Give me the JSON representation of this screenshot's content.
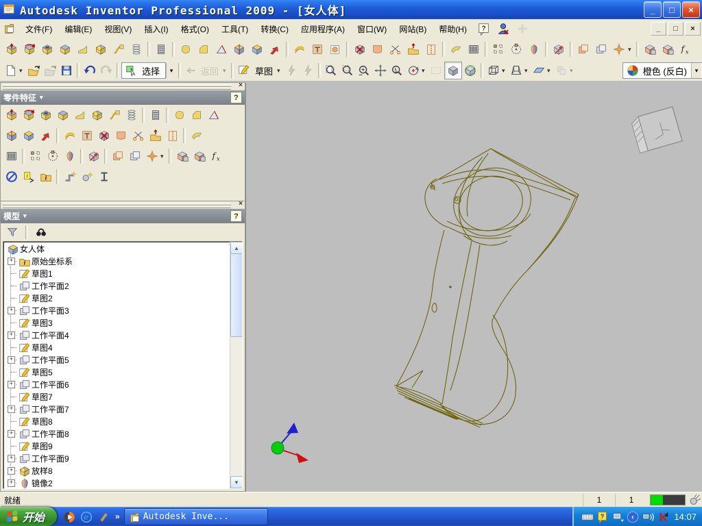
{
  "window": {
    "title": "Autodesk Inventor Professional 2009 - [女人体]",
    "buttons": {
      "minimize": "_",
      "restore": "□",
      "close": "×"
    }
  },
  "menubar": {
    "items": [
      {
        "id": "file",
        "label": "文件(F)"
      },
      {
        "id": "edit",
        "label": "编辑(E)"
      },
      {
        "id": "view",
        "label": "视图(V)"
      },
      {
        "id": "insert",
        "label": "插入(I)"
      },
      {
        "id": "format",
        "label": "格式(O)"
      },
      {
        "id": "tools",
        "label": "工具(T)"
      },
      {
        "id": "convert",
        "label": "转换(C)"
      },
      {
        "id": "applications",
        "label": "应用程序(A)"
      },
      {
        "id": "window",
        "label": "窗口(W)"
      },
      {
        "id": "web",
        "label": "网站(B)"
      },
      {
        "id": "help",
        "label": "帮助(H)"
      }
    ],
    "help_button": "?",
    "mdi_buttons": {
      "minimize": "_",
      "restore": "□",
      "close": "×"
    }
  },
  "toolbar_features": {
    "icons": [
      {
        "n": "extrude",
        "g": "arrow"
      },
      {
        "n": "revolve",
        "g": "arc"
      },
      {
        "n": "hole",
        "g": "hole"
      },
      {
        "n": "shell",
        "g": "cy"
      },
      {
        "n": "rib",
        "g": "rib"
      },
      {
        "n": "loft",
        "g": "ballcube"
      },
      {
        "n": "sweep",
        "g": "sweep"
      },
      {
        "n": "coil",
        "g": "spring"
      },
      "|",
      {
        "n": "thread",
        "g": "thread"
      },
      "|",
      {
        "n": "fillet",
        "g": "fillet"
      },
      {
        "n": "chamfer",
        "g": "chamfer"
      },
      {
        "n": "face-draft",
        "g": "wedge"
      },
      {
        "n": "split",
        "g": "split"
      },
      {
        "n": "bend-part",
        "g": "cb"
      },
      {
        "n": "move-face",
        "g": "moveface"
      },
      "|",
      {
        "n": "thicken-offset",
        "g": "thick"
      },
      {
        "n": "emboss",
        "g": "emboss"
      },
      {
        "n": "decal",
        "g": "decal"
      },
      "|",
      {
        "n": "delete-face",
        "g": "xcube"
      },
      {
        "n": "boundary-patch",
        "g": "patch"
      },
      {
        "n": "trim-surface",
        "g": "scissors"
      },
      {
        "n": "replace-face",
        "g": "promote"
      },
      {
        "n": "stitch-surface",
        "g": "stitch"
      },
      "|",
      {
        "n": "sculpt",
        "g": "sculpt"
      },
      {
        "n": "grill",
        "g": "barcode"
      },
      "|",
      {
        "n": "rectangular-pattern",
        "g": "dotsR"
      },
      {
        "n": "circular-pattern",
        "g": "dotsC"
      },
      {
        "n": "mirror",
        "g": "mirror"
      },
      "|",
      {
        "n": "move-body",
        "g": "movebody"
      },
      "|",
      {
        "n": "copy-object",
        "g": "copy"
      },
      {
        "n": "work-plane",
        "g": "wp"
      },
      {
        "n": "work-point",
        "g": "star",
        "caret": true
      },
      "|",
      {
        "n": "derive",
        "g": "cubes2"
      },
      {
        "n": "insert-ifeature",
        "g": "cubes2"
      },
      {
        "n": "parameters",
        "g": "fx"
      }
    ]
  },
  "toolbar_standard": {
    "select_label": "选择",
    "back_label": "返回",
    "sketch_label": "草图",
    "color_value": "橙色 (反白)"
  },
  "panel_features": {
    "title": "零件特征",
    "help": "?",
    "rows": [
      [
        {
          "n": "extrude",
          "g": "arrow"
        },
        {
          "n": "revolve",
          "g": "arc"
        },
        {
          "n": "hole",
          "g": "hole"
        },
        {
          "n": "shell",
          "g": "cy"
        },
        {
          "n": "rib",
          "g": "rib"
        },
        {
          "n": "loft",
          "g": "ballcube"
        },
        {
          "n": "sweep",
          "g": "sweep"
        },
        {
          "n": "coil",
          "g": "spring"
        },
        "|",
        {
          "n": "thread",
          "g": "thread"
        },
        "|",
        {
          "n": "fillet",
          "g": "fillet"
        },
        {
          "n": "chamfer",
          "g": "chamfer"
        },
        {
          "n": "face-draft",
          "g": "wedge"
        }
      ],
      [
        {
          "n": "split",
          "g": "split"
        },
        {
          "n": "bend-part",
          "g": "cb"
        },
        {
          "n": "move-face",
          "g": "moveface"
        },
        "|",
        {
          "n": "thicken-offset",
          "g": "thick"
        },
        {
          "n": "emboss",
          "g": "emboss"
        },
        {
          "n": "delete-face",
          "g": "xcube"
        },
        {
          "n": "boundary-patch",
          "g": "patch"
        },
        {
          "n": "trim-surface",
          "g": "scissors"
        },
        {
          "n": "replace-face",
          "g": "promote"
        },
        {
          "n": "stitch-surface",
          "g": "stitch"
        },
        "|",
        {
          "n": "sculpt",
          "g": "sculpt"
        }
      ],
      [
        {
          "n": "grill",
          "g": "barcode"
        },
        "|",
        {
          "n": "rectangular-pattern",
          "g": "dotsR"
        },
        {
          "n": "circular-pattern",
          "g": "dotsC"
        },
        {
          "n": "mirror",
          "g": "mirror"
        },
        "|",
        {
          "n": "move-body",
          "g": "movebody"
        },
        "|",
        {
          "n": "copy-object",
          "g": "copy"
        },
        {
          "n": "work-plane",
          "g": "wp"
        },
        {
          "n": "work-point",
          "g": "star",
          "caret": true
        },
        "|",
        {
          "n": "derive",
          "g": "cubes2"
        },
        {
          "n": "insert-ifeature",
          "g": "cubes2"
        },
        {
          "n": "parameters",
          "g": "fx"
        }
      ],
      [
        {
          "n": "disable-feature",
          "g": "nosym"
        },
        {
          "n": "create-note",
          "g": "infoNote"
        },
        {
          "n": "ifeature-catalog",
          "g": "infoFolder"
        },
        "|",
        {
          "n": "create-imate",
          "g": "imate1"
        },
        {
          "n": "composite-imate",
          "g": "imate2"
        },
        {
          "n": "structural-profile",
          "g": "ibeam"
        }
      ]
    ]
  },
  "panel_model": {
    "title": "模型",
    "help": "?",
    "tools": [
      {
        "n": "filter",
        "g": "funnel"
      },
      {
        "n": "find",
        "g": "binoc"
      }
    ],
    "tree": [
      {
        "label": "女人体",
        "icon": "part",
        "root": true
      },
      {
        "label": "原始坐标系",
        "icon": "folder",
        "expand": true
      },
      {
        "label": "草图1",
        "icon": "sketch"
      },
      {
        "label": "工作平面2",
        "icon": "workplane"
      },
      {
        "label": "草图2",
        "icon": "sketch"
      },
      {
        "label": "工作平面3",
        "icon": "workplane",
        "expand": true
      },
      {
        "label": "草图3",
        "icon": "sketch"
      },
      {
        "label": "工作平面4",
        "icon": "workplane",
        "expand": true
      },
      {
        "label": "草图4",
        "icon": "sketch"
      },
      {
        "label": "工作平面5",
        "icon": "workplane",
        "expand": true
      },
      {
        "label": "草图5",
        "icon": "sketch"
      },
      {
        "label": "工作平面6",
        "icon": "workplane",
        "expand": true
      },
      {
        "label": "草图7",
        "icon": "sketch"
      },
      {
        "label": "工作平面7",
        "icon": "workplane",
        "expand": true
      },
      {
        "label": "草图8",
        "icon": "sketch"
      },
      {
        "label": "工作平面8",
        "icon": "workplane",
        "expand": true
      },
      {
        "label": "草图9",
        "icon": "sketch"
      },
      {
        "label": "工作平面9",
        "icon": "workplane",
        "expand": true
      },
      {
        "label": "放样8",
        "icon": "loft",
        "expand": true
      },
      {
        "label": "镜像2",
        "icon": "mirrorTree",
        "expand": true
      }
    ]
  },
  "canvas": {
    "background": "#BEBEBE",
    "wire_color": "#6F650F"
  },
  "statusbar": {
    "ready": "就绪",
    "cells": [
      "1",
      "1"
    ]
  },
  "taskbar": {
    "start_label": "开始",
    "quick_launch": [
      {
        "n": "media-player",
        "g": "media"
      },
      {
        "n": "internet-explorer",
        "g": "ie"
      },
      {
        "n": "paint-brush",
        "g": "brush"
      }
    ],
    "task_label": "Autodesk Inve...",
    "tray_icons": [
      {
        "n": "keyboard",
        "g": "kbd"
      },
      {
        "n": "help-tray",
        "g": "helpTray"
      },
      {
        "n": "updates",
        "g": "winupd"
      },
      {
        "n": "language",
        "g": "langCirc"
      },
      {
        "n": "network",
        "g": "netmon"
      },
      {
        "n": "antivirus",
        "g": "kasp"
      }
    ],
    "time": "14:07"
  }
}
